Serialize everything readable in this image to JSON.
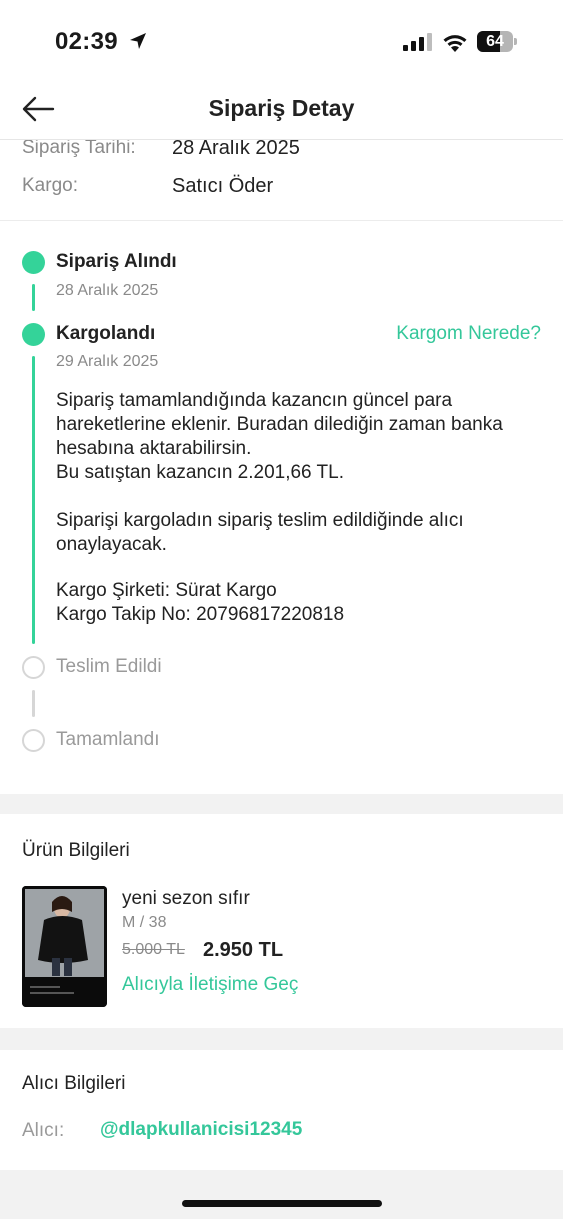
{
  "status_bar": {
    "time": "02:39",
    "battery_level": "64",
    "battery_fraction": 0.64
  },
  "nav": {
    "title": "Sipariş Detay"
  },
  "order_info": {
    "date_label": "Sipariş Tarihi:",
    "date_value": "28 Aralık 2025",
    "shipping_label": "Kargo:",
    "shipping_value": "Satıcı Öder"
  },
  "timeline": {
    "steps": [
      {
        "title": "Sipariş Alındı",
        "date": "28 Aralık 2025",
        "status": "done"
      },
      {
        "title": "Kargolandı",
        "date": "29 Aralık 2025",
        "status": "done",
        "action": "Kargom Nerede?"
      },
      {
        "title": "Teslim Edildi",
        "status": "pending"
      },
      {
        "title": "Tamamlandı",
        "status": "pending"
      }
    ],
    "description": {
      "line1": "Sipariş tamamlandığında kazancın güncel para hareketlerine eklenir. Buradan dilediğin zaman banka hesabına aktarabilirsin.",
      "line2": "Bu satıştan kazancın 2.201,66 TL.",
      "line3": "Siparişi kargoladın sipariş teslim edildiğinde alıcı onaylayacak.",
      "line4": "Kargo Şirketi: Sürat Kargo",
      "line5": "Kargo Takip No: 20796817220818"
    }
  },
  "product": {
    "section_title": "Ürün Bilgileri",
    "name": "yeni sezon sıfır",
    "variant": "M / 38",
    "old_price": "5.000 TL",
    "new_price": "2.950 TL",
    "contact_link": "Alıcıyla İletişime Geç"
  },
  "buyer": {
    "section_title": "Alıcı Bilgileri",
    "label": "Alıcı:",
    "username": "@dlapkullanicisi12345"
  },
  "colors": {
    "accent": "#34d399",
    "accent_text": "#34c79a",
    "band": "#f2f2f2"
  }
}
